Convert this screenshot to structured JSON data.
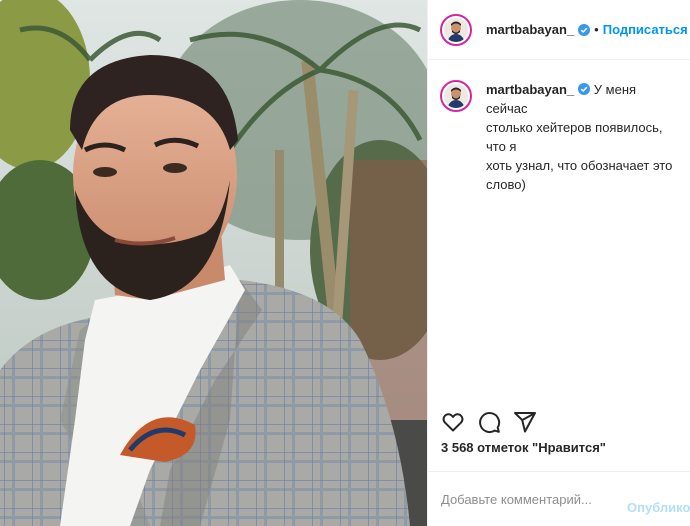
{
  "post": {
    "author": "martbabayan_",
    "verified_icon": "verified-badge-icon",
    "follow_label": "Подписаться",
    "header_separator": "•",
    "caption_lines": [
      "У меня сейчас",
      "столько хейтеров появилось, что я",
      "хоть узнал, что обозначает это",
      "слово)"
    ],
    "likes_text": "3 568 отметок \"Нравится\"",
    "comment_placeholder": "Добавьте комментарий...",
    "publish_label": "Опубликовать",
    "actions": [
      "heart-icon",
      "comment-icon",
      "share-icon"
    ]
  },
  "colors": {
    "link_blue": "#0095f6",
    "publish_disabled": "#b2dffc",
    "verified_blue": "#3897f0",
    "ring": "#d6249f"
  }
}
